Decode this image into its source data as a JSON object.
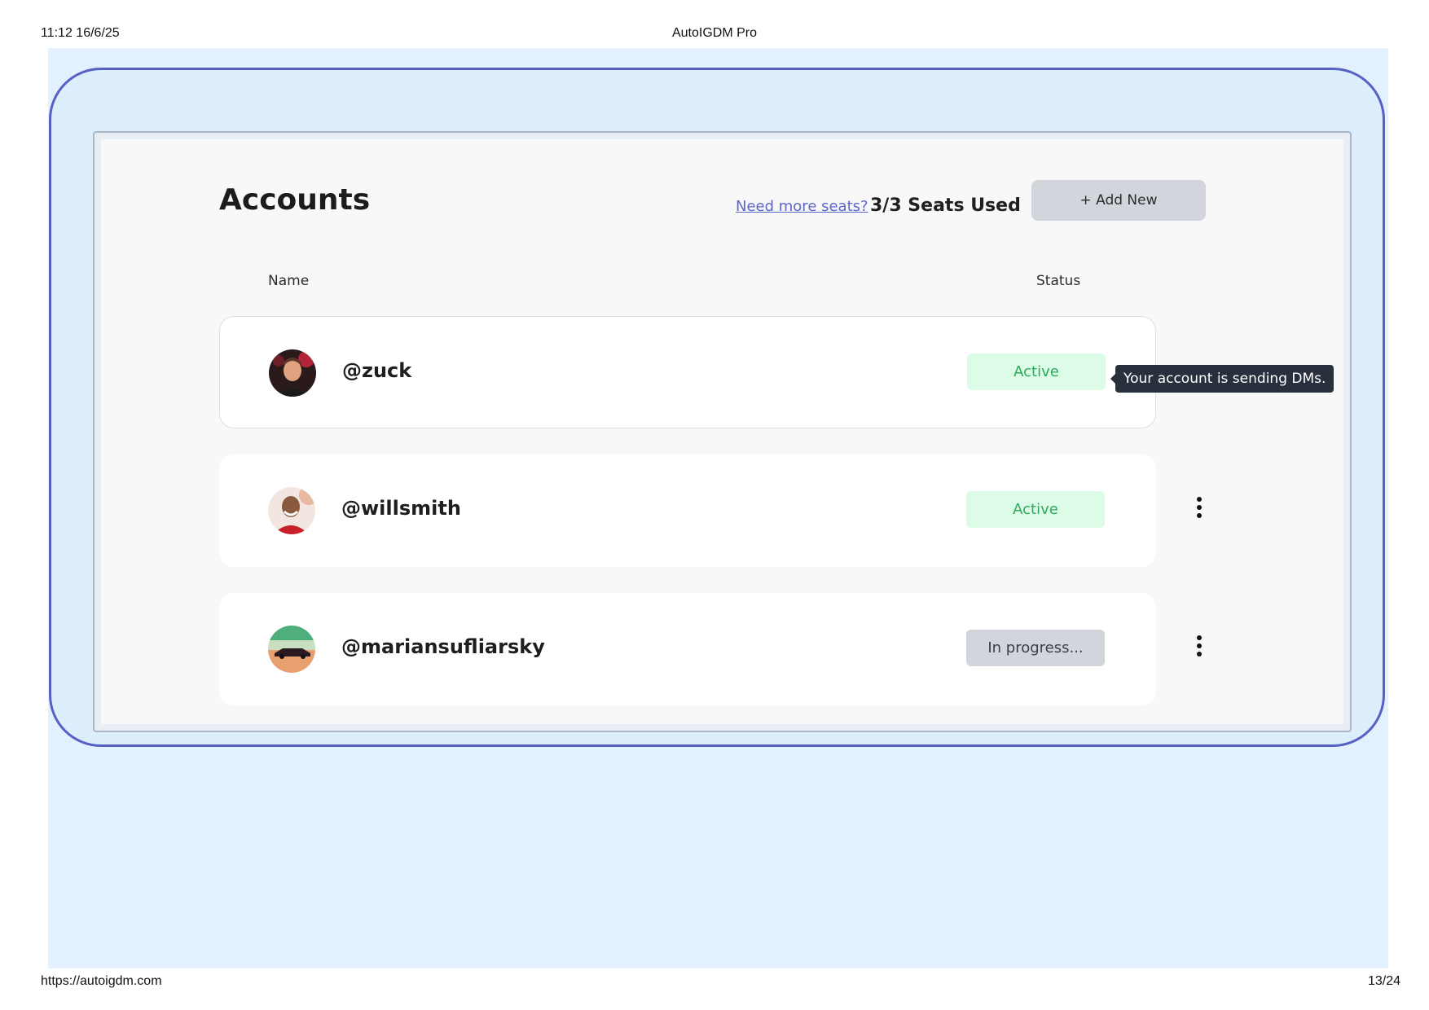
{
  "print_header": {
    "timestamp": "11:12 16/6/25",
    "title": "AutoIGDM Pro"
  },
  "print_footer": {
    "url": "https://autoigdm.com",
    "page": "13/24"
  },
  "accounts": {
    "title": "Accounts",
    "need_more_seats": "Need more seats?",
    "seats_used": "3/3 Seats Used",
    "add_new_label": "+ Add New",
    "columns": {
      "name": "Name",
      "status": "Status"
    },
    "rows": [
      {
        "handle": "@zuck",
        "status": "Active"
      },
      {
        "handle": "@willsmith",
        "status": "Active"
      },
      {
        "handle": "@mariansufliarsky",
        "status": "In progress..."
      }
    ],
    "tooltip": "Your account is sending DMs."
  },
  "colors": {
    "accent": "#5660c4",
    "active_bg": "#dcfce7",
    "active_text": "#2eaa5c",
    "progress_bg": "#d2d5dc",
    "tooltip_bg": "#28303d"
  },
  "icons": {
    "row_menu": "kebab-menu-icon",
    "avatar": "avatar-photo"
  }
}
